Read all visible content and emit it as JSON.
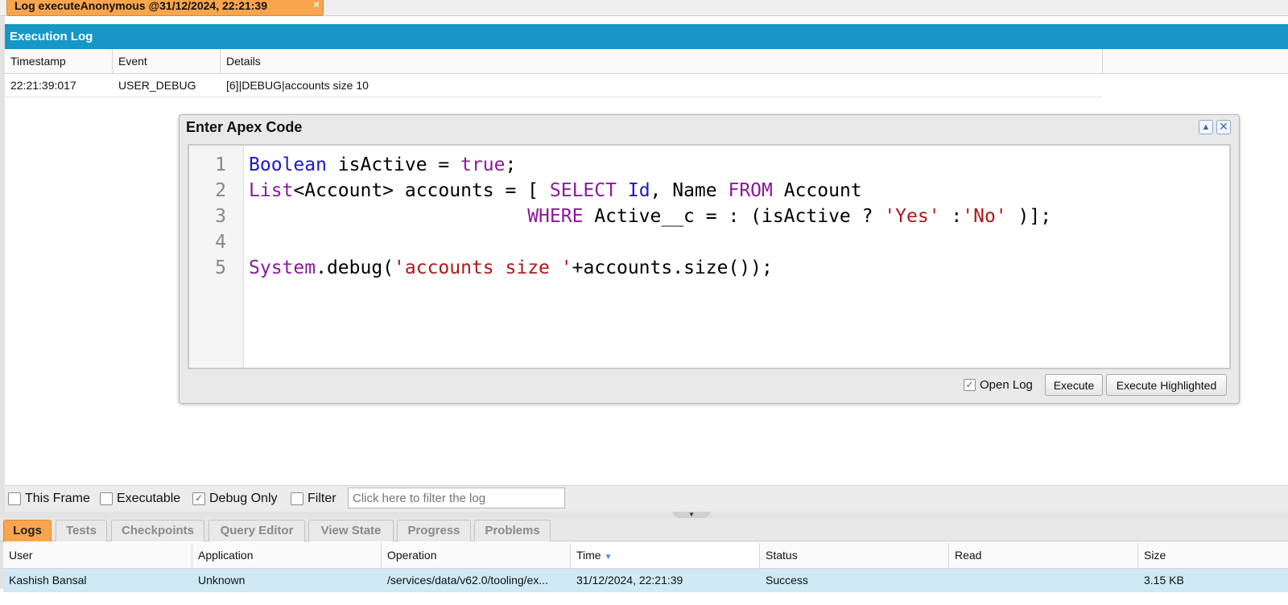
{
  "window_tab": {
    "title": "Log executeAnonymous @31/12/2024, 22:21:39",
    "close": "×"
  },
  "execution_log": {
    "header": "Execution Log",
    "columns": [
      "Timestamp",
      "Event",
      "Details"
    ],
    "rows": [
      {
        "timestamp": "22:21:39:017",
        "event": "USER_DEBUG",
        "details": "[6]|DEBUG|accounts size 10"
      }
    ]
  },
  "apex_modal": {
    "title": "Enter Apex Code",
    "minimize_icon": "▲",
    "close_icon": "✕",
    "line_numbers": [
      "1",
      "2",
      "3",
      "4",
      "5"
    ],
    "code": {
      "l1": {
        "a": "Boolean",
        "b": " isActive = ",
        "c": "true",
        "d": ";"
      },
      "l2": {
        "a": "List",
        "b": "<Account> accounts = [ ",
        "c": "SELECT",
        "d": " ",
        "e": "Id",
        "f": ", Name ",
        "g": "FROM",
        "h": " Account"
      },
      "l3": {
        "pad": "                         ",
        "a": "WHERE",
        "b": " Active__c = : (isActive ? ",
        "c": "'Yes'",
        "d": " :",
        "e": "'No'",
        "f": " )];"
      },
      "l5": {
        "a": "System",
        "b": ".debug(",
        "c": "'accounts size '",
        "d": "+accounts.size());"
      }
    },
    "open_log_label": "Open Log",
    "open_log_checked": true,
    "execute_label": "Execute",
    "execute_highlighted_label": "Execute Highlighted"
  },
  "filters": {
    "this_frame": "This Frame",
    "executable": "Executable",
    "debug_only": "Debug Only",
    "filter": "Filter",
    "filter_placeholder": "Click here to filter the log",
    "debug_only_checked": true
  },
  "bottom_tabs": [
    "Logs",
    "Tests",
    "Checkpoints",
    "Query Editor",
    "View State",
    "Progress",
    "Problems"
  ],
  "logs_table": {
    "columns": [
      "User",
      "Application",
      "Operation",
      "Time",
      "Status",
      "Read",
      "Size"
    ],
    "rows": [
      {
        "user": "Kashish Bansal",
        "application": "Unknown",
        "operation": "/services/data/v62.0/tooling/ex...",
        "time": "31/12/2024, 22:21:39",
        "status": "Success",
        "read": "",
        "size": "3.15 KB"
      }
    ]
  },
  "colors": {
    "accent_orange": "#f8a54e",
    "header_blue": "#1797c5",
    "selected_row": "#cfe9f5"
  }
}
